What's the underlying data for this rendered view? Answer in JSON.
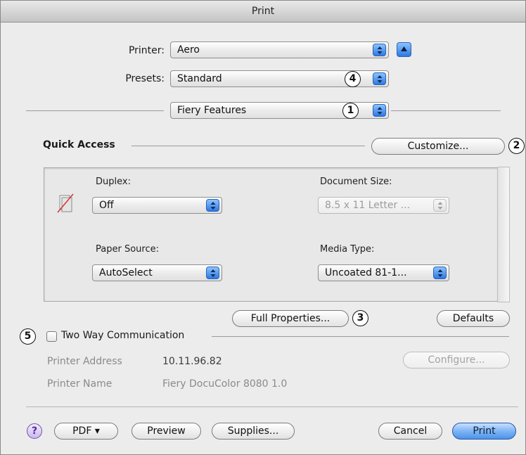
{
  "window": {
    "title": "Print"
  },
  "printer": {
    "label": "Printer:",
    "value": "Aero"
  },
  "presets": {
    "label": "Presets:",
    "value": "Standard"
  },
  "section_popup": {
    "value": "Fiery Features"
  },
  "quick_access": {
    "title": "Quick Access",
    "customize_label": "Customize...",
    "duplex": {
      "label": "Duplex:",
      "value": "Off"
    },
    "document_size": {
      "label": "Document Size:",
      "value": "8.5 x 11 Letter ..."
    },
    "paper_source": {
      "label": "Paper Source:",
      "value": "AutoSelect"
    },
    "media_type": {
      "label": "Media Type:",
      "value": "Uncoated 81-1..."
    },
    "full_properties_label": "Full Properties...",
    "defaults_label": "Defaults"
  },
  "two_way": {
    "checkbox_label": "Two Way Communication",
    "checked": false,
    "printer_address_label": "Printer Address",
    "printer_address": "10.11.96.82",
    "printer_name_label": "Printer Name",
    "printer_name": "Fiery DocuColor 8080 1.0",
    "configure_label": "Configure..."
  },
  "callouts": {
    "n1": "1",
    "n2": "2",
    "n3": "3",
    "n4": "4",
    "n5": "5"
  },
  "footer": {
    "help_glyph": "?",
    "pdf_label": "PDF ▾",
    "preview_label": "Preview",
    "supplies_label": "Supplies...",
    "cancel_label": "Cancel",
    "print_label": "Print"
  },
  "colors": {
    "accent_blue": "#2d78e3",
    "window_bg": "#ececec"
  },
  "icons": {
    "duplex": "duplex-off-icon",
    "stepper": "updown-arrows-icon",
    "collapse": "triangle-up-icon",
    "help": "question-mark-icon"
  }
}
